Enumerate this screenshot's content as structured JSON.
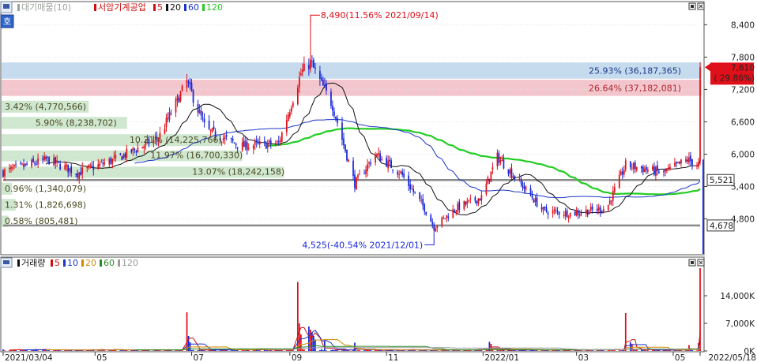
{
  "legend_price": {
    "items": [
      {
        "label": "대기매물(10)",
        "color": "#9aa39a"
      },
      {
        "label": "서암기계공업",
        "color": "#d01010"
      },
      {
        "label": "5",
        "color": "#d01010"
      },
      {
        "label": "20",
        "color": "#111111"
      },
      {
        "label": "60",
        "color": "#1b35c8"
      },
      {
        "label": "120",
        "color": "#22cc22"
      }
    ]
  },
  "legend_volume": {
    "items": [
      {
        "label": "거래량",
        "color": "#111111"
      },
      {
        "label": "5",
        "color": "#d01010"
      },
      {
        "label": "10",
        "color": "#1b35c8"
      },
      {
        "label": "20",
        "color": "#d08a00"
      },
      {
        "label": "60",
        "color": "#2a8a2a"
      },
      {
        "label": "120",
        "color": "#9a9a9a"
      }
    ]
  },
  "side_badge": "호",
  "colors": {
    "up": "#e0101a",
    "down": "#1626d8",
    "ma5": "#d01010",
    "ma20": "#111111",
    "ma60": "#1b35c8",
    "ma120": "#22cc22",
    "supply_band": "#cfe7cf",
    "band_blue": "#c6dcee",
    "band_pink": "#f2c6cc",
    "hline": "#8a8a8a"
  },
  "chart_data": [
    {
      "type": "candlestick",
      "title": "서암기계공업",
      "ylim": [
        4150,
        8800
      ],
      "y_ticks": [
        "8,400",
        "7,800",
        "7,200",
        "6,600",
        "6,000",
        "5,400",
        "4,800"
      ],
      "y_tick_values": [
        8400,
        7800,
        7200,
        6600,
        6000,
        5400,
        4800
      ],
      "x_labels": [
        "2021/03/04",
        "05",
        "07",
        "09",
        "11",
        "2022/01",
        "03",
        "05",
        "2022/05/18"
      ],
      "x_label_dates": [
        "2021-03-04",
        "2021-05-01",
        "2021-07-01",
        "2021-09-01",
        "2021-11-01",
        "2022-01-01",
        "2022-03-01",
        "2022-05-01",
        "2022-05-18"
      ],
      "x_range": [
        "2021-03-04",
        "2022-05-18"
      ],
      "anchors": [
        {
          "date": "2021-03-04",
          "price": 5670
        },
        {
          "date": "2021-04-01",
          "price": 5900
        },
        {
          "date": "2021-04-20",
          "price": 5650
        },
        {
          "date": "2021-05-15",
          "price": 5920
        },
        {
          "date": "2021-06-10",
          "price": 6300
        },
        {
          "date": "2021-06-28",
          "price": 7350
        },
        {
          "date": "2021-07-10",
          "price": 6450
        },
        {
          "date": "2021-08-01",
          "price": 6150
        },
        {
          "date": "2021-08-25",
          "price": 6200
        },
        {
          "date": "2021-09-08",
          "price": 7500
        },
        {
          "date": "2021-09-14",
          "price": 7700
        },
        {
          "date": "2021-09-28",
          "price": 6900
        },
        {
          "date": "2021-10-12",
          "price": 5450
        },
        {
          "date": "2021-10-25",
          "price": 6000
        },
        {
          "date": "2021-11-10",
          "price": 5650
        },
        {
          "date": "2021-11-25",
          "price": 5000
        },
        {
          "date": "2021-12-01",
          "price": 4650
        },
        {
          "date": "2021-12-15",
          "price": 5000
        },
        {
          "date": "2021-12-31",
          "price": 5200
        },
        {
          "date": "2022-01-10",
          "price": 5950
        },
        {
          "date": "2022-01-22",
          "price": 5550
        },
        {
          "date": "2022-02-08",
          "price": 4950
        },
        {
          "date": "2022-02-25",
          "price": 4900
        },
        {
          "date": "2022-03-20",
          "price": 5000
        },
        {
          "date": "2022-04-01",
          "price": 5800
        },
        {
          "date": "2022-04-25",
          "price": 5650
        },
        {
          "date": "2022-05-10",
          "price": 5900
        },
        {
          "date": "2022-05-17",
          "price": 5800
        },
        {
          "date": "2022-05-18",
          "price": 7610
        }
      ],
      "volatility": 1.0,
      "high_marker": {
        "price": 8490,
        "date": "2021-09-14",
        "label": "8,490(11.56% 2021/09/14)"
      },
      "low_marker": {
        "price": 4525,
        "date": "2021-12-01",
        "label": "4,525(-40.54% 2021/12/01)"
      },
      "current": {
        "price": "7,610",
        "change": "( 29.86%)",
        "price_value": 7610
      },
      "horizontal_levels": [
        {
          "value": 5521,
          "label": "5,521"
        },
        {
          "value": 4678,
          "label": "4,678"
        }
      ],
      "highlight_bands": [
        {
          "from": 7400,
          "to": 7700,
          "label": "25.93% (36,187,365)",
          "color": "#c6dcee"
        },
        {
          "from": 7080,
          "to": 7380,
          "label": "26.64% (37,182,081)",
          "color": "#f2c6cc"
        }
      ],
      "supply_zones": [
        {
          "from": 6770,
          "to": 6990,
          "share": 0.25,
          "label": "3.42% (4,770,566)"
        },
        {
          "from": 6470,
          "to": 6690,
          "share": 0.36,
          "label": "5.90% (8,238,702)"
        },
        {
          "from": 6150,
          "to": 6370,
          "share": 0.63,
          "label": "10.21% (14,225,766)"
        },
        {
          "from": 5870,
          "to": 6070,
          "share": 0.69,
          "label": "11.97% (16,700,330)"
        },
        {
          "from": 5560,
          "to": 5770,
          "share": 0.81,
          "label": "13.07% (18,242,158)"
        },
        {
          "from": 5250,
          "to": 5470,
          "share": 0.03,
          "label": "0.96% (1,340,079)"
        },
        {
          "from": 4950,
          "to": 5170,
          "share": 0.04,
          "label": "1.31% (1,826,698)"
        },
        {
          "from": 4650,
          "to": 4860,
          "share": 0.02,
          "label": "0.58% (805,481)"
        }
      ]
    },
    {
      "type": "bar",
      "title": "거래량",
      "ylim": [
        0,
        21000
      ],
      "y_ticks": [
        "14,000K",
        "7,000K",
        "0K"
      ],
      "y_tick_values": [
        14000,
        7000,
        0
      ],
      "units": "K",
      "baseline": 280,
      "spikes": [
        {
          "date": "2021-06-28",
          "value": 9800
        },
        {
          "date": "2021-06-29",
          "value": 3800
        },
        {
          "date": "2021-06-30",
          "value": 2200
        },
        {
          "date": "2021-09-06",
          "value": 17500
        },
        {
          "date": "2021-09-07",
          "value": 7000
        },
        {
          "date": "2021-09-08",
          "value": 4200
        },
        {
          "date": "2021-09-13",
          "value": 6200
        },
        {
          "date": "2021-09-14",
          "value": 5400
        },
        {
          "date": "2021-09-15",
          "value": 4700
        },
        {
          "date": "2021-09-16",
          "value": 3800
        },
        {
          "date": "2021-09-17",
          "value": 2900
        },
        {
          "date": "2021-09-23",
          "value": 2500
        },
        {
          "date": "2021-10-12",
          "value": 2100
        },
        {
          "date": "2022-01-05",
          "value": 2300
        },
        {
          "date": "2022-01-06",
          "value": 1800
        },
        {
          "date": "2022-04-01",
          "value": 9600
        },
        {
          "date": "2022-04-04",
          "value": 2200
        },
        {
          "date": "2022-04-05",
          "value": 1800
        },
        {
          "date": "2022-05-11",
          "value": 1500
        },
        {
          "date": "2022-05-17",
          "value": 2000
        },
        {
          "date": "2022-05-18",
          "value": 21000
        }
      ]
    }
  ]
}
